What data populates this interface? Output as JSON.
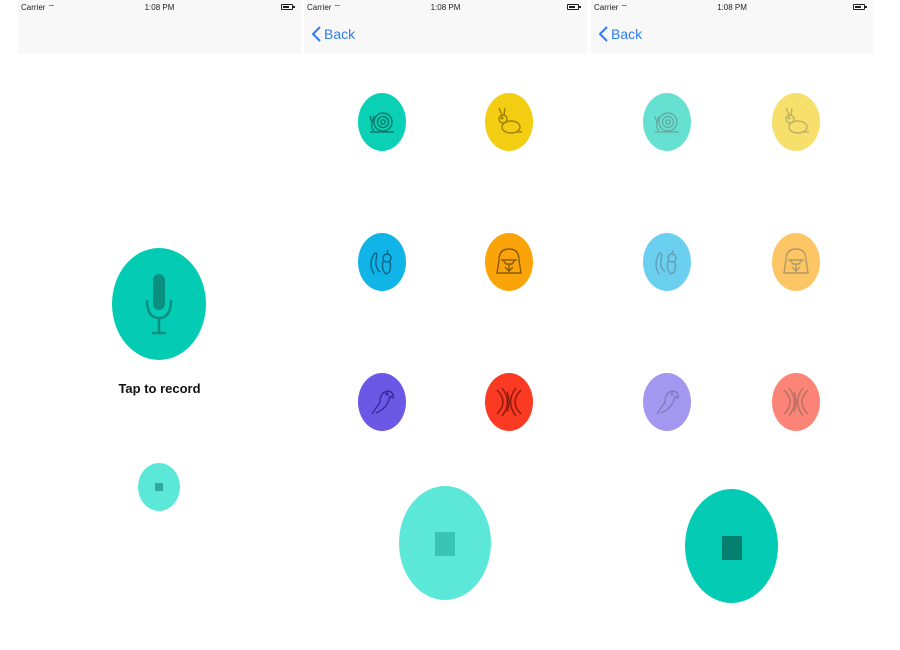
{
  "status_bar": {
    "carrier": "Carrier",
    "time": "1:08 PM"
  },
  "nav": {
    "back_label": "Back"
  },
  "record_screen": {
    "tap_label": "Tap to record"
  },
  "effects": [
    {
      "name": "snail",
      "color": "#0ad0b6"
    },
    {
      "name": "rabbit",
      "color": "#f2cd12"
    },
    {
      "name": "squirrel",
      "color": "#11b4e6"
    },
    {
      "name": "darth-vader",
      "color": "#fba40a"
    },
    {
      "name": "parrot",
      "color": "#6b59e6"
    },
    {
      "name": "echo",
      "color": "#fb3a24"
    }
  ],
  "colors": {
    "accent": "#04ccb4",
    "stop_light": "#5be8d9",
    "back_blue": "#2c7cf6"
  }
}
